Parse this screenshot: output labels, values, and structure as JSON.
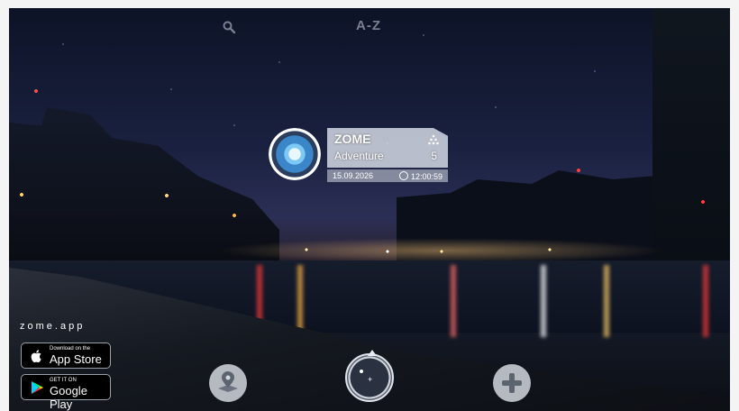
{
  "header": {
    "search_icon": "search-icon",
    "sort_label": "A-Z"
  },
  "zone": {
    "title": "ZOME",
    "category": "Adventure",
    "count": "5",
    "date": "15.09.2026",
    "time": "12:00:59",
    "accent_color": "#3a86c8"
  },
  "brand": {
    "site": "zome.app"
  },
  "stores": {
    "apple_small": "Download on the",
    "apple_big": "App Store",
    "google_small": "GET IT ON",
    "google_big": "Google Play"
  },
  "controls": {
    "map_icon": "map-pin-icon",
    "compass_icon": "compass-icon",
    "add_icon": "plus-icon"
  }
}
